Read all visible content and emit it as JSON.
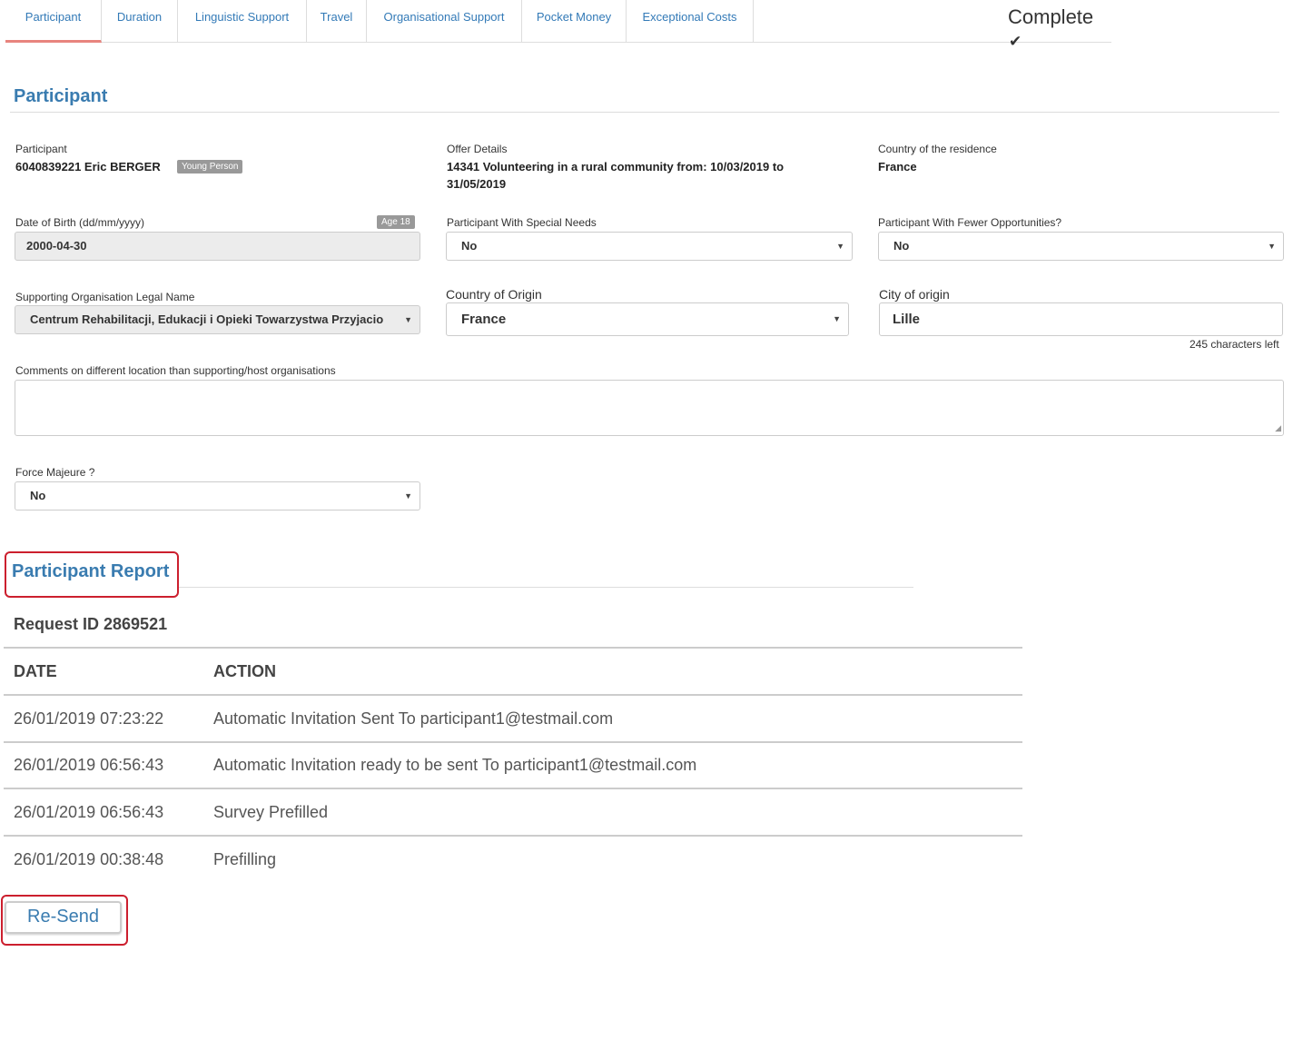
{
  "tabs": [
    {
      "label": "Participant"
    },
    {
      "label": "Duration"
    },
    {
      "label": "Linguistic Support"
    },
    {
      "label": "Travel"
    },
    {
      "label": "Organisational Support"
    },
    {
      "label": "Pocket Money"
    },
    {
      "label": "Exceptional Costs"
    }
  ],
  "status": {
    "label": "Complete",
    "icon": "✔"
  },
  "participant_section": {
    "title": "Participant"
  },
  "fields": {
    "participant": {
      "label": "Participant",
      "value": "6040839221 Eric BERGER",
      "badge": "Young Person"
    },
    "offer": {
      "label": "Offer Details",
      "value": "14341 Volunteering in a rural community from: 10/03/2019 to 31/05/2019"
    },
    "residence": {
      "label": "Country of the residence",
      "value": "France"
    },
    "dob": {
      "label": "Date of Birth (dd/mm/yyyy)",
      "badge": "Age 18",
      "value": "2000-04-30"
    },
    "special_needs": {
      "label": "Participant With Special Needs",
      "value": "No"
    },
    "fewer_opportunities": {
      "label": "Participant With Fewer Opportunities?",
      "value": "No"
    },
    "supporting_org": {
      "label": "Supporting Organisation Legal Name",
      "value": "Centrum Rehabilitacji, Edukacji i Opieki Towarzystwa Przyjacio"
    },
    "country_origin": {
      "label": "Country of Origin",
      "value": "France"
    },
    "city_origin": {
      "label": "City of origin",
      "value": "Lille",
      "counter": "245 characters left"
    },
    "comments": {
      "label": "Comments on different location than supporting/host organisations",
      "value": ""
    },
    "force_majeure": {
      "label": "Force Majeure ?",
      "value": "No"
    }
  },
  "report": {
    "title": "Participant Report",
    "request_id": "Request ID 2869521",
    "columns": [
      "DATE",
      "ACTION"
    ],
    "rows": [
      {
        "date": "26/01/2019 07:23:22",
        "action": "Automatic Invitation Sent To participant1@testmail.com"
      },
      {
        "date": "26/01/2019 06:56:43",
        "action": "Automatic Invitation ready to be sent To participant1@testmail.com"
      },
      {
        "date": "26/01/2019 06:56:43",
        "action": "Survey Prefilled"
      },
      {
        "date": "26/01/2019 00:38:48",
        "action": "Prefilling"
      }
    ],
    "resend_label": "Re-Send"
  },
  "colors": {
    "accent": "#3a7cb0",
    "active_tab_underline": "#e8847e",
    "highlight": "#cc1f2e"
  }
}
